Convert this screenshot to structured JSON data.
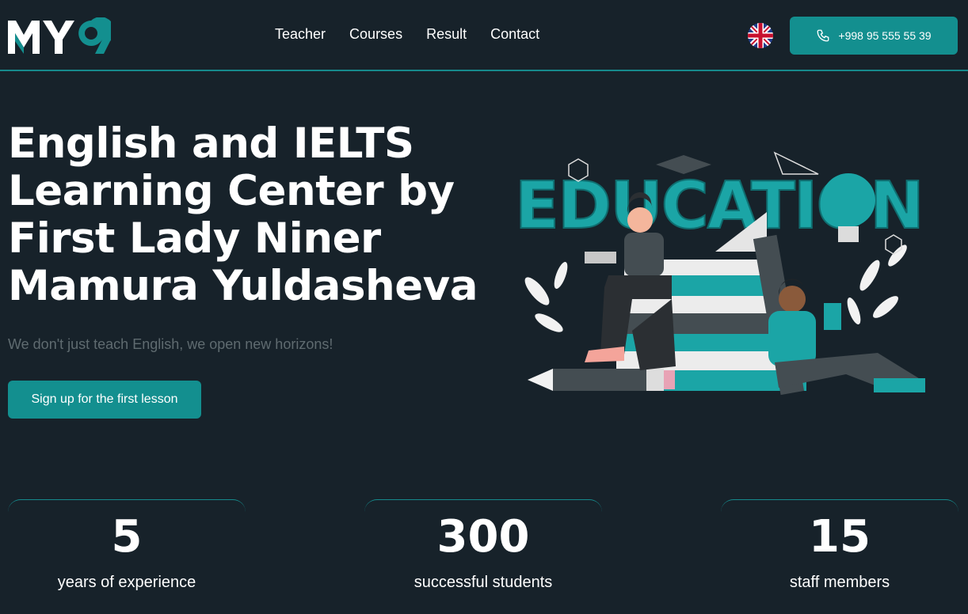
{
  "brand": {
    "logo_text": "MY9",
    "accent": "#138f8f",
    "background": "#17222a"
  },
  "nav": {
    "items": [
      {
        "label": "Teacher"
      },
      {
        "label": "Courses"
      },
      {
        "label": "Result"
      },
      {
        "label": "Contact"
      }
    ]
  },
  "lang": {
    "current": "English (UK)",
    "icon": "uk-flag-icon"
  },
  "contact": {
    "phone": "+998 95 555 55 39",
    "icon": "phone-icon"
  },
  "hero": {
    "title_lines": [
      "English and IELTS",
      "Learning Center by",
      "First Lady Niner",
      "Mamura Yuldasheva"
    ],
    "subtitle": "We don't just teach English, we open new horizons!",
    "cta": "Sign up for the first lesson"
  },
  "illustration": {
    "word": "EDUCATION"
  },
  "stats": [
    {
      "value": "5",
      "label": "years of experience"
    },
    {
      "value": "300",
      "label": "successful students"
    },
    {
      "value": "15",
      "label": "staff members"
    }
  ]
}
